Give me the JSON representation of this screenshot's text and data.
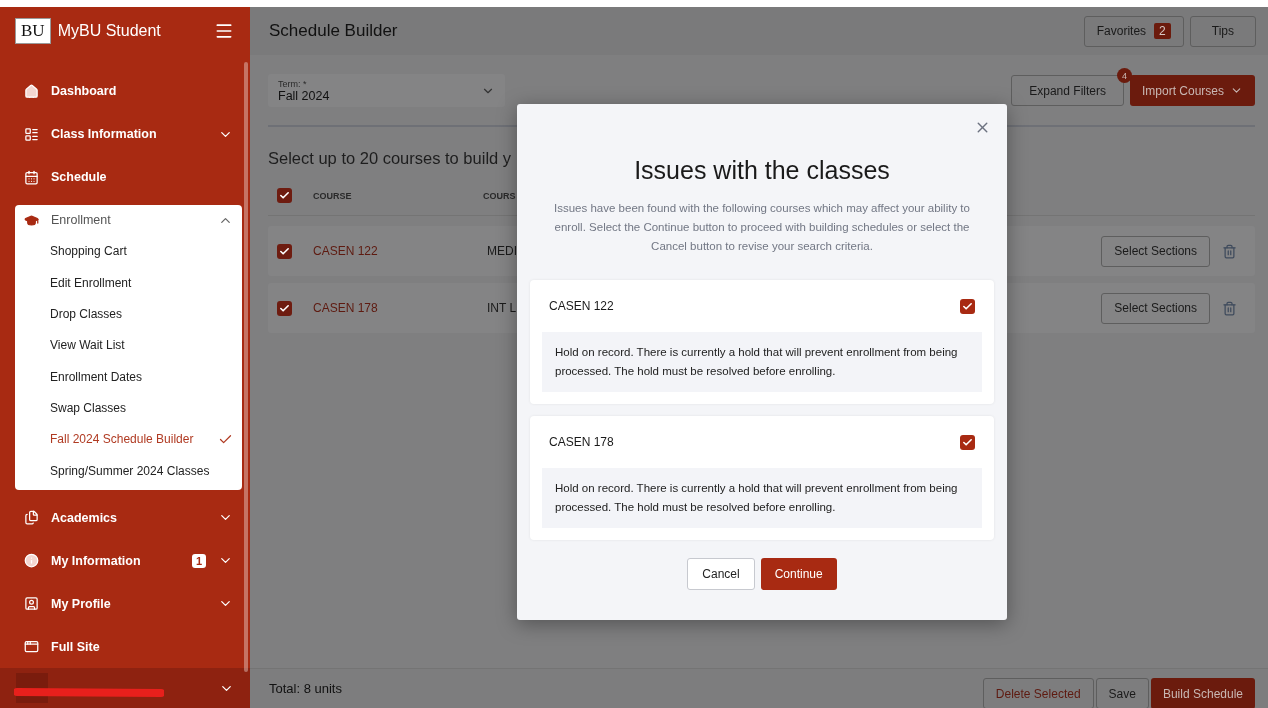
{
  "app": {
    "logo": "BU",
    "title": "MyBU Student"
  },
  "sidebar": {
    "items": [
      {
        "label": "Dashboard",
        "expandable": false,
        "expanded": false
      },
      {
        "label": "Class Information",
        "expandable": true,
        "expanded": false
      },
      {
        "label": "Schedule",
        "expandable": false,
        "expanded": false
      },
      {
        "label": "Enrollment",
        "expandable": true,
        "expanded": true,
        "children": [
          {
            "label": "Shopping Cart",
            "selected": false
          },
          {
            "label": "Edit Enrollment",
            "selected": false
          },
          {
            "label": "Drop Classes",
            "selected": false
          },
          {
            "label": "View Wait List",
            "selected": false
          },
          {
            "label": "Enrollment Dates",
            "selected": false
          },
          {
            "label": "Swap Classes",
            "selected": false
          },
          {
            "label": "Fall 2024 Schedule Builder",
            "selected": true
          },
          {
            "label": "Spring/Summer 2024 Classes",
            "selected": false
          }
        ]
      },
      {
        "label": "Academics",
        "expandable": true,
        "expanded": false
      },
      {
        "label": "My Information",
        "expandable": true,
        "expanded": false,
        "badge": "1"
      },
      {
        "label": "My Profile",
        "expandable": true,
        "expanded": false
      },
      {
        "label": "Full Site",
        "expandable": false,
        "expanded": false
      }
    ]
  },
  "page": {
    "title": "Schedule Builder",
    "header_buttons": [
      {
        "label": "Favorites",
        "badge": "2"
      },
      {
        "label": "Tips"
      }
    ]
  },
  "term": {
    "label": "Term: *",
    "value": "Fall 2024"
  },
  "filters": {
    "expand": {
      "label": "Expand Filters",
      "badge": "4"
    },
    "import": {
      "label": "Import Courses"
    }
  },
  "instructions": "Select up to 20 courses to build y",
  "table": {
    "header_checked": true,
    "columns": [
      "COURSE",
      "COURS"
    ],
    "rows": [
      {
        "checked": true,
        "course": "CASEN 122",
        "column_2": "MEDI",
        "action": "Select Sections"
      },
      {
        "checked": true,
        "course": "CASEN 178",
        "column_2": "INT L",
        "action": "Select Sections"
      }
    ]
  },
  "footer": {
    "total": "Total: 8 units",
    "buttons": [
      {
        "label": "Delete Selected",
        "kind": "danger"
      },
      {
        "label": "Save",
        "kind": "outline"
      },
      {
        "label": "Build Schedule",
        "kind": "primary"
      }
    ]
  },
  "modal": {
    "title": "Issues with the classes",
    "description": "Issues have been found with the following courses which may affect your ability to enroll. Select the Continue button to proceed with building schedules or select the Cancel button to revise your search criteria.",
    "issues": [
      {
        "course": "CASEN 122",
        "checked": true,
        "message": "Hold on record. There is currently a hold that will prevent enrollment from being processed. The hold must be resolved before enrolling."
      },
      {
        "course": "CASEN 178",
        "checked": true,
        "message": "Hold on record. There is currently a hold that will prevent enrollment from being processed. The hold must be resolved before enrolling."
      }
    ],
    "buttons": [
      {
        "label": "Cancel",
        "kind": "secondary"
      },
      {
        "label": "Continue",
        "kind": "primary"
      }
    ]
  }
}
